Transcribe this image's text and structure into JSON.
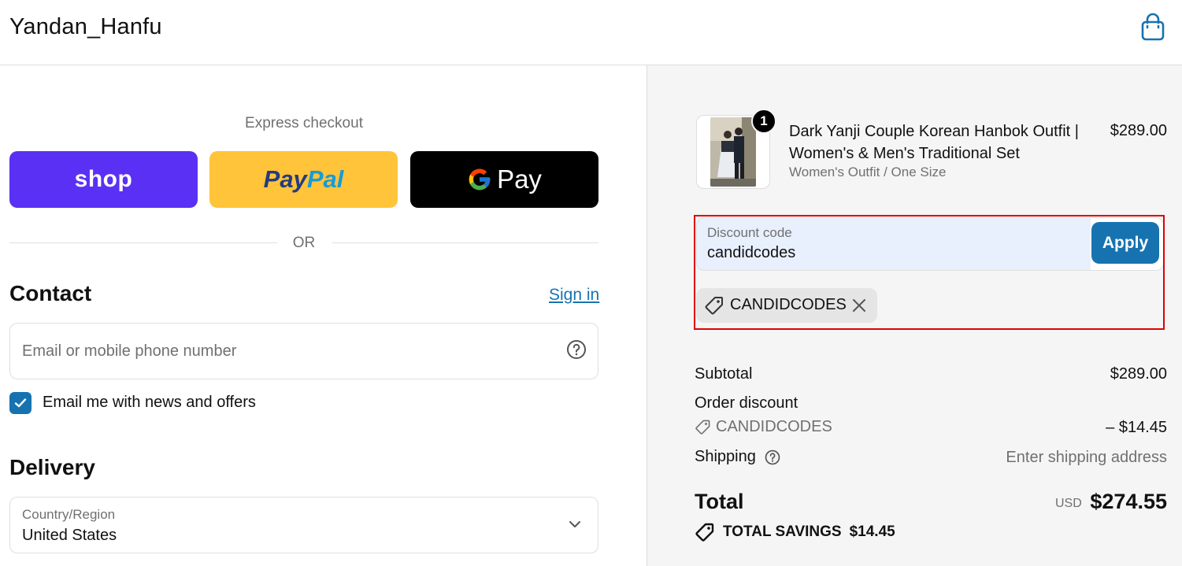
{
  "header": {
    "brand": "Yandan_Hanfu",
    "cart_icon": "shopping-bag-icon"
  },
  "express": {
    "title": "Express checkout",
    "shop_label": "shop",
    "paypal_label_1": "Pay",
    "paypal_label_2": "Pal",
    "gpay_label": "Pay",
    "colors": {
      "shop": "#5a31f4",
      "paypal": "#ffc439",
      "gpay": "#000000"
    }
  },
  "divider": {
    "or": "OR"
  },
  "contact": {
    "title": "Contact",
    "sign_in": "Sign in",
    "email_placeholder": "Email or mobile phone number",
    "newsletter_label": "Email me with news and offers",
    "newsletter_checked": true
  },
  "delivery": {
    "title": "Delivery",
    "country_label": "Country/Region",
    "country_value": "United States"
  },
  "summary": {
    "item": {
      "quantity": "1",
      "title": "Dark Yanji Couple Korean Hanbok Outfit | Women's & Men's Traditional Set",
      "variant": "Women's Outfit / One Size",
      "price": "$289.00"
    },
    "discount": {
      "label": "Discount code",
      "value": "candidcodes",
      "apply": "Apply",
      "applied_code": "CANDIDCODES"
    },
    "subtotal_label": "Subtotal",
    "subtotal_value": "$289.00",
    "order_discount_label": "Order discount",
    "order_discount_code": "CANDIDCODES",
    "order_discount_value": "– $14.45",
    "shipping_label": "Shipping",
    "shipping_value": "Enter shipping address",
    "total_label": "Total",
    "total_currency": "USD",
    "total_value": "$274.55",
    "savings_label": "TOTAL SAVINGS",
    "savings_value": "$14.45"
  },
  "accent": "#1773b0",
  "highlight": "#e00000"
}
